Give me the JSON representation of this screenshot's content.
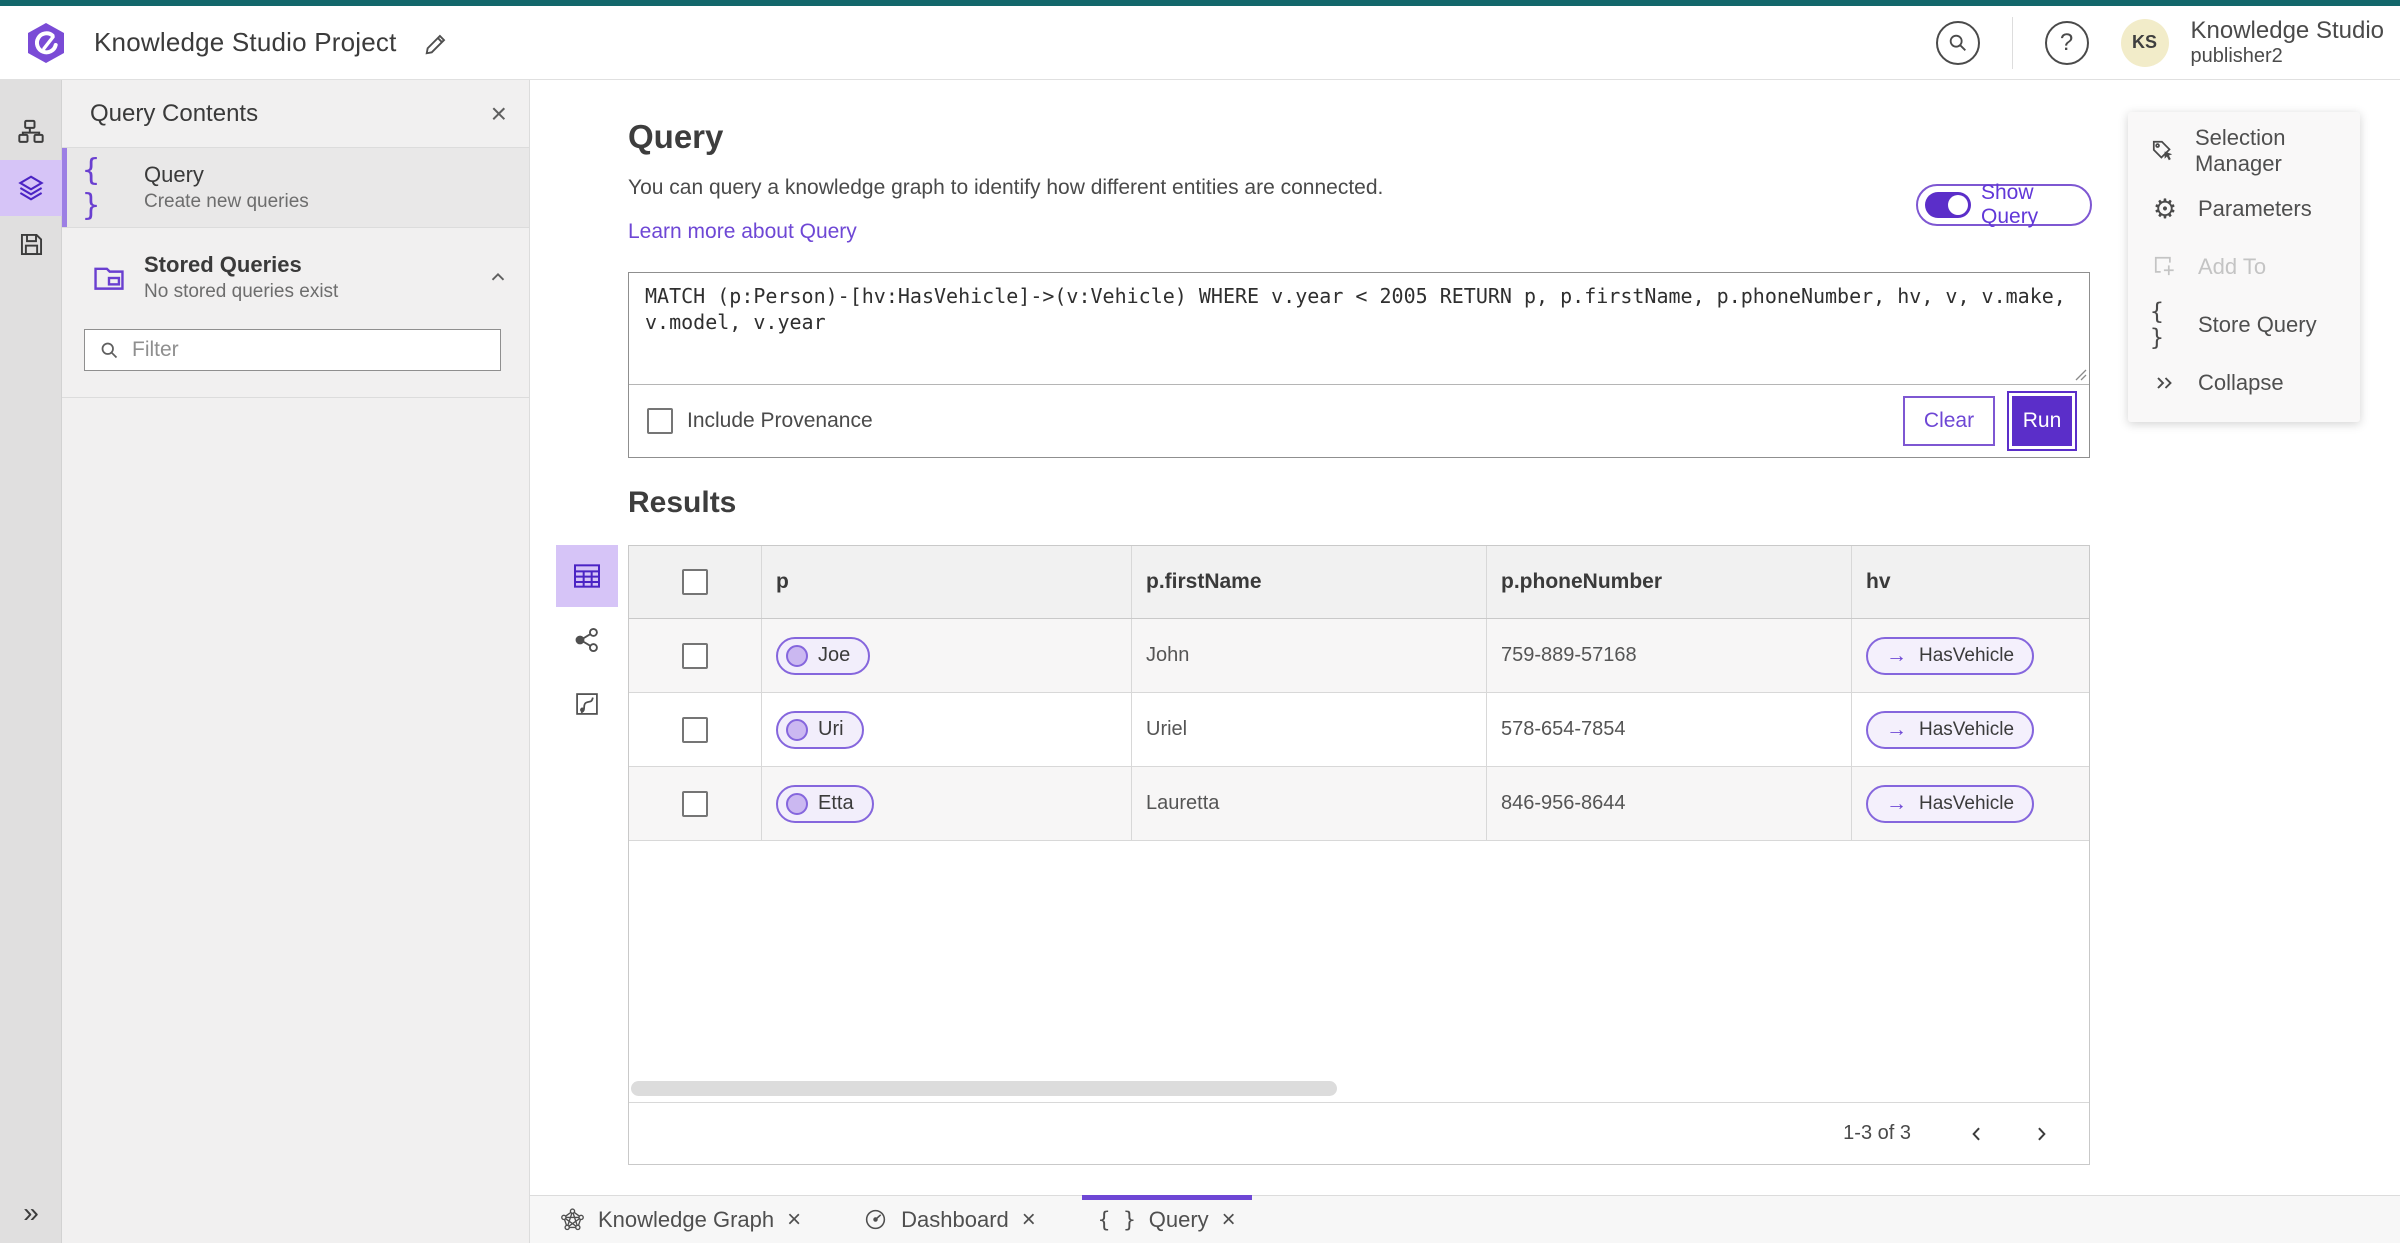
{
  "header": {
    "app_title": "Knowledge Studio Project",
    "account_name": "Knowledge Studio",
    "account_user": "publisher2",
    "avatar_initials": "KS",
    "help_glyph": "?"
  },
  "sidebar": {
    "title": "Query Contents",
    "query_item": {
      "title": "Query",
      "subtitle": "Create new queries"
    },
    "stored_queries": {
      "title": "Stored Queries",
      "subtitle": "No stored queries exist"
    },
    "filter_placeholder": "Filter"
  },
  "query_panel": {
    "title": "Query",
    "description": "You can query a knowledge graph to identify how different entities are connected.",
    "learn_more": "Learn more about Query",
    "show_query_label": "Show Query",
    "query_text": "MATCH (p:Person)-[hv:HasVehicle]->(v:Vehicle) WHERE v.year < 2005 RETURN p, p.firstName, p.phoneNumber, hv, v, v.make, v.model, v.year",
    "include_provenance_label": "Include Provenance",
    "clear_label": "Clear",
    "run_label": "Run"
  },
  "results": {
    "title": "Results",
    "columns": [
      "p",
      "p.firstName",
      "p.phoneNumber",
      "hv"
    ],
    "rows": [
      {
        "p": "Joe",
        "firstName": "John",
        "phone": "759-889-57168",
        "hv": "HasVehicle"
      },
      {
        "p": "Uri",
        "firstName": "Uriel",
        "phone": "578-654-7854",
        "hv": "HasVehicle"
      },
      {
        "p": "Etta",
        "firstName": "Lauretta",
        "phone": "846-956-8644",
        "hv": "HasVehicle"
      }
    ],
    "pagination": {
      "range_label": "1-3 of 3"
    }
  },
  "right_menu": {
    "items": [
      {
        "label": "Selection Manager",
        "disabled": false
      },
      {
        "label": "Parameters",
        "disabled": false
      },
      {
        "label": "Add To",
        "disabled": true
      },
      {
        "label": "Store Query",
        "disabled": false
      },
      {
        "label": "Collapse",
        "disabled": false
      }
    ]
  },
  "tabs": [
    {
      "label": "Knowledge Graph",
      "active": false
    },
    {
      "label": "Dashboard",
      "active": false
    },
    {
      "label": "Query",
      "active": true
    }
  ],
  "icons": {
    "close_glyph": "×",
    "braces_glyph": "{ }",
    "arrow_glyph": "→",
    "collapse_rail_glyph": "»",
    "gear_glyph": "⚙"
  },
  "colors": {
    "accent_purple": "#6e47d5",
    "deep_purple": "#5b2ec9",
    "top_strip_teal": "#13676b",
    "rail_selected_bg": "#d6c4f7",
    "avatar_bg": "#f2ecc9"
  }
}
